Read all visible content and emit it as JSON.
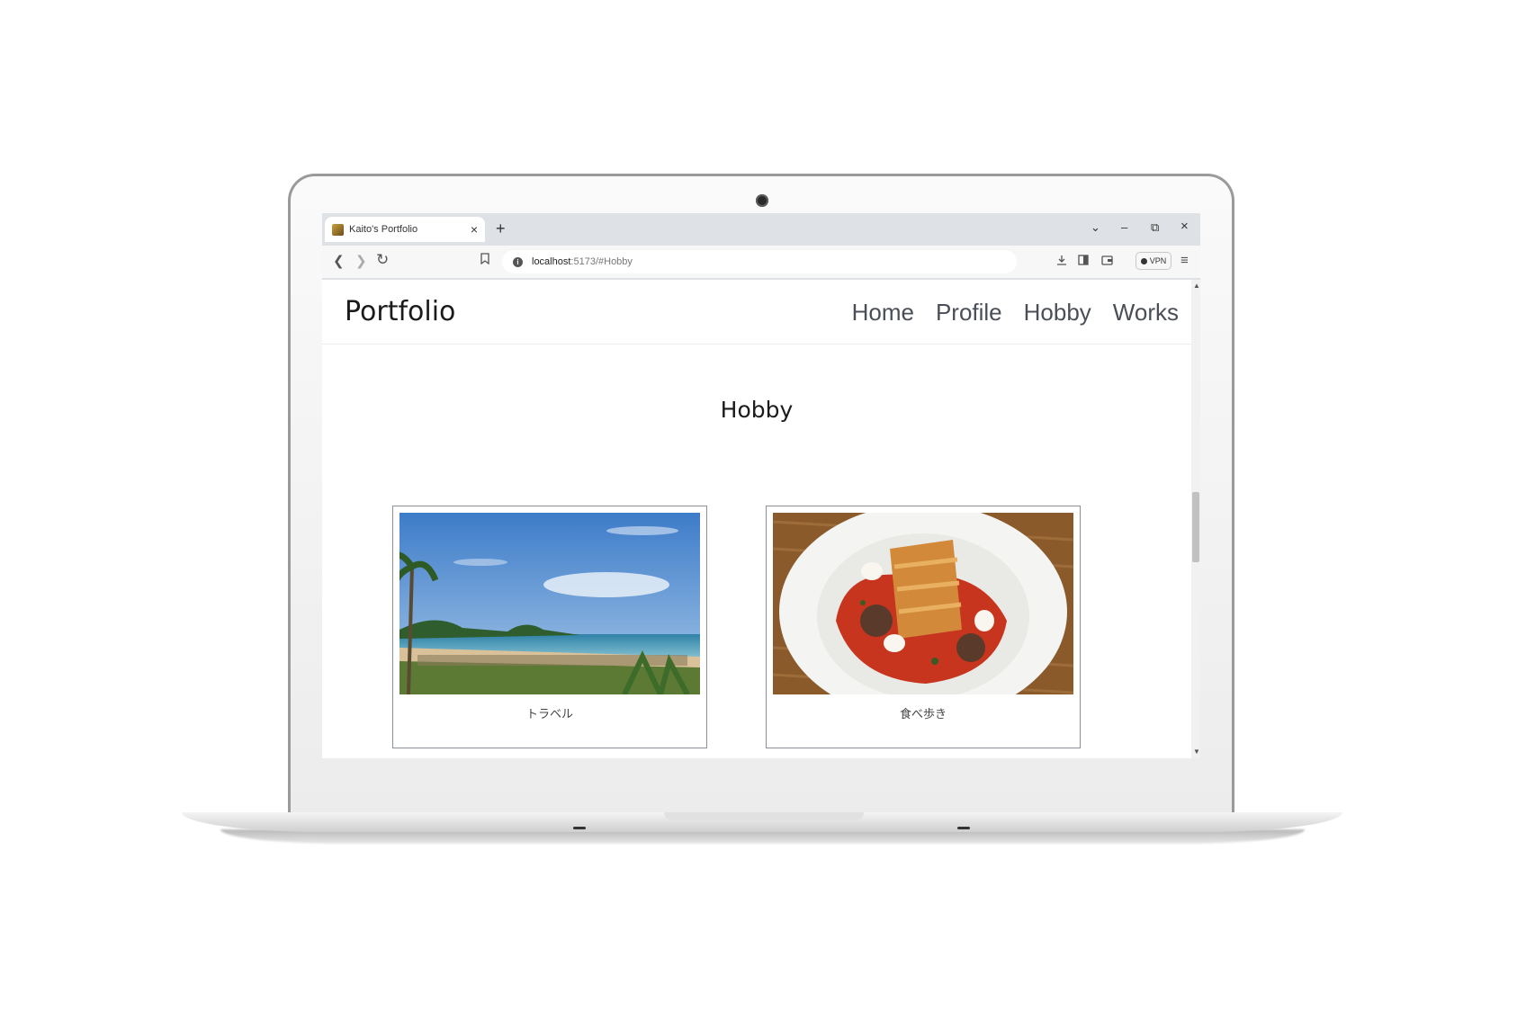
{
  "browser": {
    "tab_title": "Kaito's Portfolio",
    "tab_close": "×",
    "new_tab": "+",
    "window_controls": {
      "tabs_menu": "⌄",
      "minimize": "–",
      "restore": "⧉",
      "close": "×"
    },
    "url": {
      "host": "localhost",
      "rest": ":5173/#Hobby"
    },
    "vpn_label": "VPN"
  },
  "site": {
    "logo": "Portfolio",
    "nav": [
      "Home",
      "Profile",
      "Hobby",
      "Works"
    ],
    "section_title": "Hobby",
    "cards": [
      {
        "label": "トラベル",
        "image": "beach-photo"
      },
      {
        "label": "食べ歩き",
        "image": "food-photo"
      }
    ]
  },
  "colors": {
    "accent_text": "#1b1b1b",
    "nav_text": "#4a4f57",
    "card_border": "#8a8f98"
  }
}
